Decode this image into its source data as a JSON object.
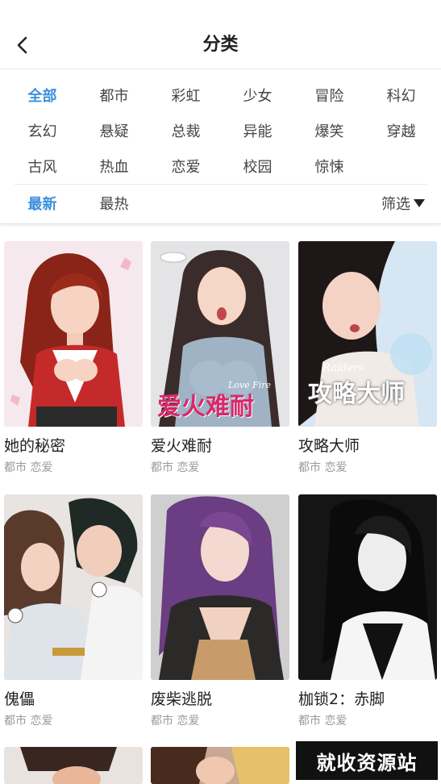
{
  "header": {
    "title": "分类"
  },
  "genres": [
    "全部",
    "都市",
    "彩虹",
    "少女",
    "冒险",
    "科幻",
    "玄幻",
    "悬疑",
    "总裁",
    "异能",
    "爆笑",
    "穿越",
    "古风",
    "热血",
    "恋爱",
    "校园",
    "惊悚"
  ],
  "sort": {
    "latest": "最新",
    "hottest": "最热",
    "filter": "筛选"
  },
  "colors": {
    "accent": "#3b8fde"
  },
  "comics": [
    {
      "title": "她的秘密",
      "tags": "都市 恋爱"
    },
    {
      "title": "爱火难耐",
      "tags": "都市 恋爱",
      "cover_text": "爱火难耐",
      "cover_subtext": "Love Fire"
    },
    {
      "title": "攻略大师",
      "tags": "都市 恋爱",
      "cover_text": "攻略大师",
      "cover_subtext": "Raiders"
    },
    {
      "title": "傀儡",
      "tags": "都市 恋爱"
    },
    {
      "title": "废柴逃脱",
      "tags": "都市 恋爱"
    },
    {
      "title": "枷锁2：赤脚",
      "tags": "都市 恋爱"
    }
  ],
  "watermark": "就收资源站"
}
